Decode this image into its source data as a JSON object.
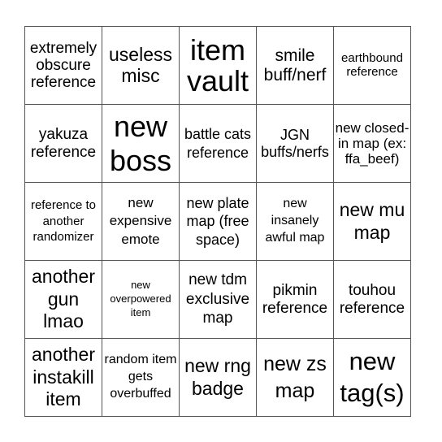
{
  "card": {
    "border_color": "#555555",
    "rows": [
      [
        "extremely obscure reference",
        "useless misc",
        "item vault",
        "smile buff/nerf",
        "earthbound reference"
      ],
      [
        "yakuza reference",
        "new boss",
        "battle cats reference",
        "JGN buffs/nerfs",
        "new closed-in map (ex: ffa_beef)"
      ],
      [
        "reference to another randomizer",
        "new expensive emote",
        "new plate map (free space)",
        "new insanely awful map",
        "new mu map"
      ],
      [
        "another gun lmao",
        "new overpowered item",
        "new tdm exclusive map",
        "pikmin reference",
        "touhou reference"
      ],
      [
        "another instakill item",
        "random item gets overbuffed",
        "new rng badge",
        "new zs map",
        "new tag(s)"
      ]
    ]
  }
}
